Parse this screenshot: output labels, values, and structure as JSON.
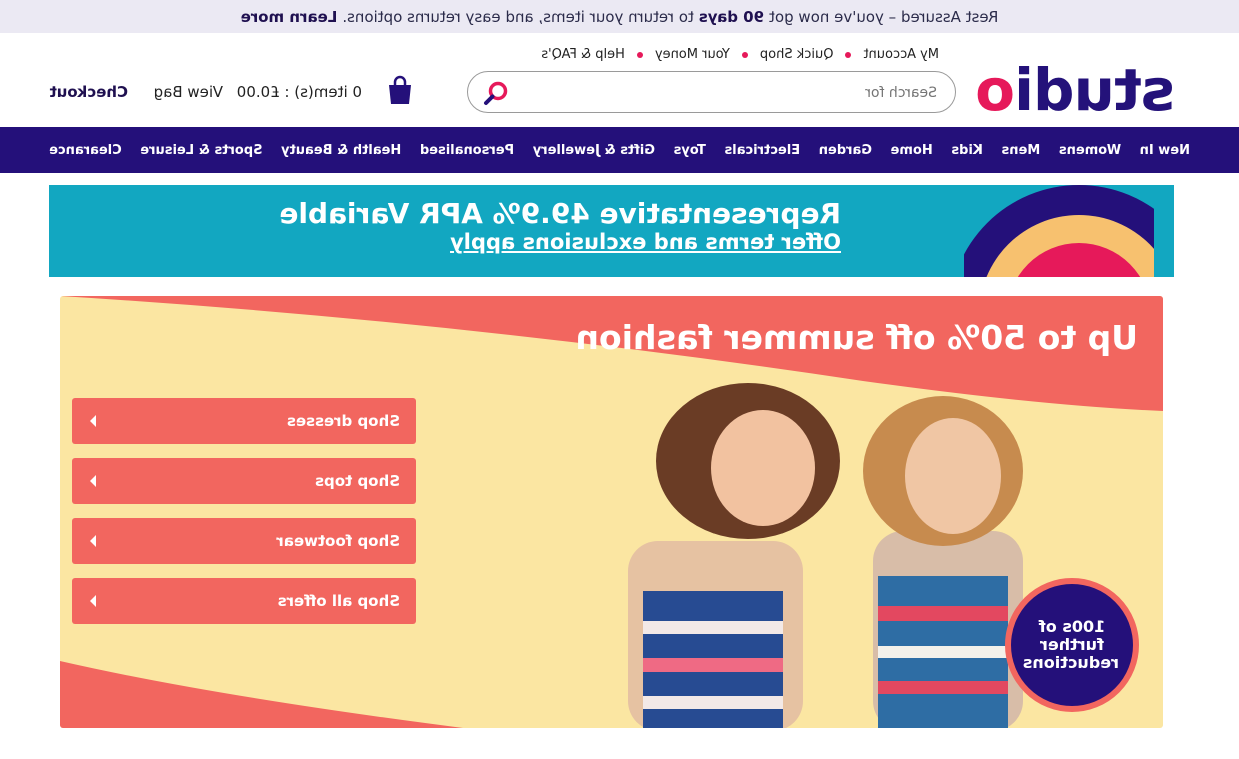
{
  "topbar": {
    "pre": "Rest Assured – you've now got",
    "bold": "90 days",
    "post": "to return your items, and easy returns options.",
    "link": "Learn more"
  },
  "logo": {
    "text_a": "stud",
    "text_o": "o",
    "text_i": "i"
  },
  "toplinks": [
    "My Account",
    "Quick Shop",
    "Your Money",
    "Help & FAQ's"
  ],
  "search": {
    "placeholder": "Search for",
    "icon": "search-icon"
  },
  "bag": {
    "icon": "bag-icon",
    "summary": "0 item(s) : £0.00",
    "view": "View Bag",
    "checkout": "Checkout"
  },
  "nav": [
    "New In",
    "Womens",
    "Mens",
    "Kids",
    "Home",
    "Garden",
    "Electricals",
    "Toys",
    "Gifts & Jewellery",
    "Personalised",
    "Health & Beauty",
    "Sports & Leisure",
    "Clearance"
  ],
  "apr": {
    "line1": "Representative 49.9% APR Variable",
    "line2": "Offer terms and exclusions apply"
  },
  "hero": {
    "title": "Up to 50% off summer fashion",
    "buttons": [
      "Shop dresses",
      "Shop tops",
      "Shop footwear",
      "Shop all offers"
    ],
    "badge": "100s of further reductions"
  },
  "colors": {
    "navy": "#24107a",
    "pink": "#e6195a",
    "coral": "#f2665f",
    "teal": "#12a7c1",
    "cream": "#fbe6a2"
  }
}
